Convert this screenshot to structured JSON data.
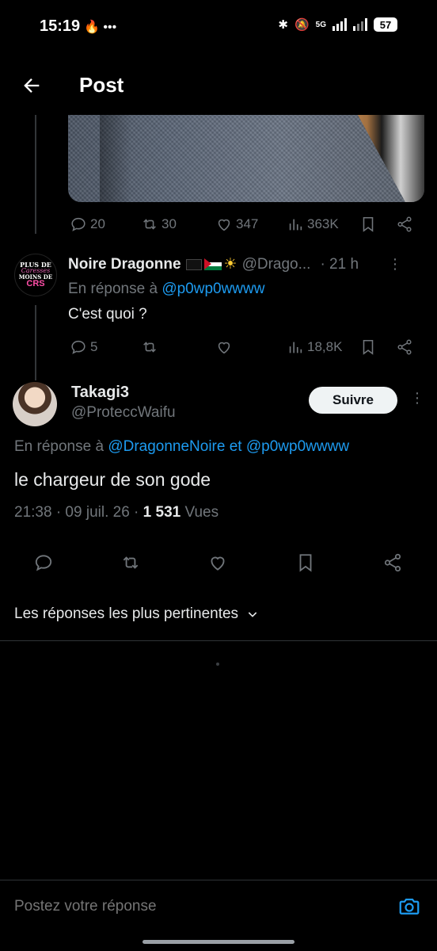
{
  "status_bar": {
    "time": "15:19",
    "left_icons": "•••",
    "network": "5G",
    "battery": "57"
  },
  "header": {
    "title": "Post",
    "back_icon": "arrow-left-icon"
  },
  "thread_tweet": {
    "stats": {
      "replies": "20",
      "retweets": "30",
      "likes": "347",
      "views": "363K"
    }
  },
  "reply_tweet": {
    "avatar_text": [
      "PLUS DE",
      "Caresses",
      "MOINS DE",
      "CRS"
    ],
    "display_name": "Noire Dragonne",
    "handle": "@Drago...",
    "time": "· 21 h",
    "reply_prefix": "En réponse à",
    "reply_mention": "@p0wp0wwww",
    "text": "C'est quoi ?",
    "stats": {
      "replies": "5",
      "retweets": "",
      "likes": "",
      "views": "18,8K"
    }
  },
  "main_tweet": {
    "display_name": "Takagi3",
    "handle": "@ProteccWaifu",
    "follow_label": "Suivre",
    "reply_prefix": "En réponse à",
    "reply_mention_1": "@DragonneNoire",
    "reply_joiner": "et",
    "reply_mention_2": "@p0wp0wwww",
    "text": "le chargeur de son gode",
    "timestamp": "21:38 · 09 juil. 26 ·",
    "views_count": "1 531",
    "views_label": "Vues"
  },
  "sort": {
    "label": "Les réponses les plus pertinentes"
  },
  "compose": {
    "placeholder": "Postez votre réponse"
  },
  "colors": {
    "accent": "#1d9bf0",
    "muted": "#71767b",
    "text": "#e7e9ea",
    "background": "#000000"
  }
}
